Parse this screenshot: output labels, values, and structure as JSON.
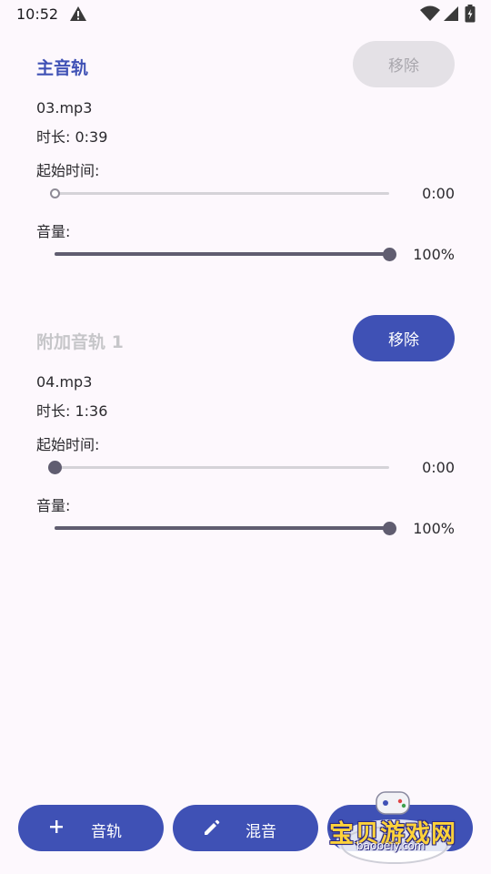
{
  "status_bar": {
    "time": "10:52",
    "icons": [
      "warning-icon",
      "wifi-icon",
      "signal-icon",
      "battery-icon"
    ]
  },
  "tracks": [
    {
      "title": "主音轨",
      "title_state": "active",
      "remove_label": "移除",
      "remove_enabled": false,
      "file": "03.mp3",
      "duration": "时长: 0:39",
      "start_label": "起始时间:",
      "start_value": "0:00",
      "start_fraction": 0,
      "volume_label": "音量:",
      "volume_value": "100%",
      "volume_fraction": 1
    },
    {
      "title": "附加音轨 1",
      "title_state": "inactive",
      "remove_label": "移除",
      "remove_enabled": true,
      "file": "04.mp3",
      "duration": "时长: 1:36",
      "start_label": "起始时间:",
      "start_value": "0:00",
      "start_fraction": 0,
      "volume_label": "音量:",
      "volume_value": "100%",
      "volume_fraction": 1
    }
  ],
  "bottom_bar": {
    "add_track_label": "音轨",
    "mix_label": "混音",
    "third_label": ""
  },
  "watermark": {
    "text": "宝贝游戏网",
    "url": "baobeiy.com"
  },
  "colors": {
    "accent": "#3f51b5",
    "background": "#fdf8fd",
    "slider": "#605d70"
  }
}
